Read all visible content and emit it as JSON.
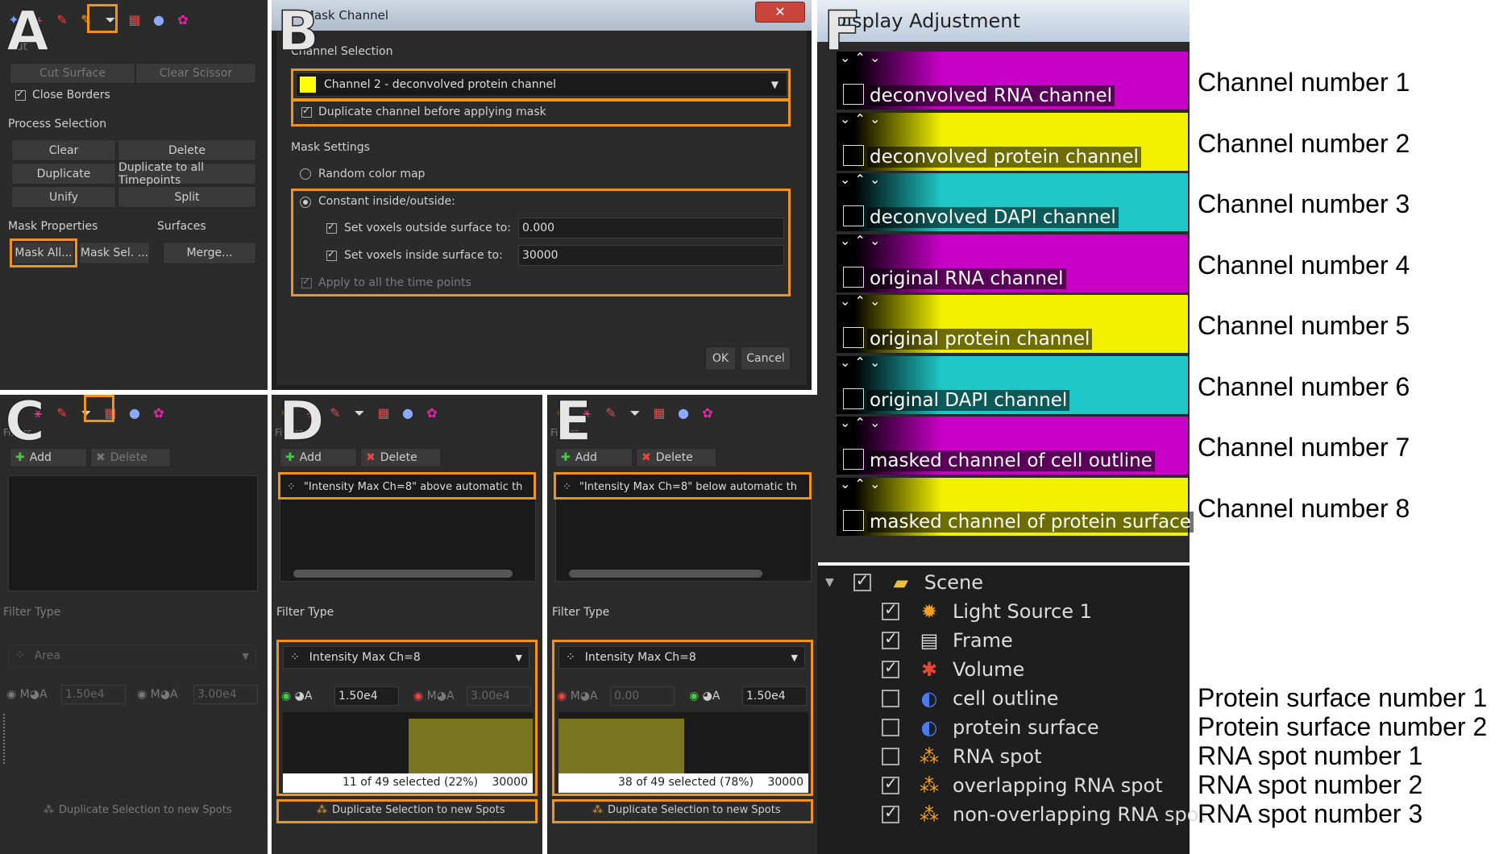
{
  "panels": {
    "a": "A",
    "b": "B",
    "c": "C",
    "d": "D",
    "e": "E",
    "f": "F"
  },
  "panelA": {
    "cut_title": "Cut",
    "cut_surface": "Cut Surface",
    "clear_scissor": "Clear Scissor",
    "close_borders": "Close Borders",
    "process_selection": "Process Selection",
    "clear": "Clear",
    "delete": "Delete",
    "duplicate": "Duplicate",
    "duplicate_all": "Duplicate to all Timepoints",
    "unify": "Unify",
    "split": "Split",
    "mask_properties": "Mask Properties",
    "surfaces": "Surfaces",
    "mask_all": "Mask All...",
    "mask_sel": "Mask Sel. ...",
    "merge": "Merge..."
  },
  "panelB": {
    "title": "Mask Channel",
    "close": "✕",
    "channel_selection": "Channel Selection",
    "channel_value": "Channel 2 - deconvolved protein channel",
    "duplicate_channel": "Duplicate channel before applying mask",
    "mask_settings": "Mask Settings",
    "random_color": "Random color map",
    "constant": "Constant inside/outside:",
    "outside_label": "Set voxels outside surface to:",
    "outside_value": "0.000",
    "inside_label": "Set voxels inside surface to:",
    "inside_value": "30000",
    "apply_all": "Apply to all the time points",
    "ok": "OK",
    "cancel": "Cancel"
  },
  "panelC": {
    "filters": "Filters",
    "add": "Add",
    "delete": "Delete",
    "filter_type": "Filter Type",
    "type_value": "Area",
    "min_value": "1.50e4",
    "max_value": "3.00e4",
    "dup": "Duplicate Selection to new Spots"
  },
  "panelD": {
    "filters": "Filters",
    "add": "Add",
    "delete": "Delete",
    "filter_item": "\"Intensity Max Ch=8\" above automatic th",
    "filter_type": "Filter Type",
    "type_value": "Intensity Max Ch=8",
    "min_value": "1.50e4",
    "max_value": "3.00e4",
    "status": "11 of 49 selected (22%)",
    "status_max": "30000",
    "dup": "Duplicate Selection to new Spots"
  },
  "panelE": {
    "filters": "Filters",
    "add": "Add",
    "delete": "Delete",
    "filter_item": "\"Intensity Max Ch=8\" below automatic th",
    "filter_type": "Filter Type",
    "type_value": "Intensity Max Ch=8",
    "min_value": "0.00",
    "max_value": "1.50e4",
    "status": "38 of 49 selected (78%)",
    "status_max": "30000",
    "dup": "Duplicate Selection to new Spots"
  },
  "panelF": {
    "title": "Display Adjustment",
    "channels": [
      {
        "name": "deconvolved RNA channel",
        "label": "Channel number 1",
        "color": "#c800c8"
      },
      {
        "name": "deconvolved protein channel",
        "label": "Channel number 2",
        "color": "#f2f200"
      },
      {
        "name": "deconvolved DAPI channel",
        "label": "Channel number 3",
        "color": "#1ec8c8"
      },
      {
        "name": "original RNA channel",
        "label": "Channel number 4",
        "color": "#c800c8"
      },
      {
        "name": "original protein channel",
        "label": "Channel number 5",
        "color": "#f2f200"
      },
      {
        "name": "original DAPI channel",
        "label": "Channel number 6",
        "color": "#1ec8c8"
      },
      {
        "name": "masked channel of cell outline",
        "label": "Channel number 7",
        "color": "#c800c8"
      },
      {
        "name": "masked channel of protein surface",
        "label": "Channel number 8",
        "color": "#f2f200"
      }
    ]
  },
  "scene": {
    "root": "Scene",
    "items": [
      {
        "name": "Light Source 1",
        "checked": true,
        "icon": "light-icon",
        "label": ""
      },
      {
        "name": "Frame",
        "checked": true,
        "icon": "frame-icon",
        "label": ""
      },
      {
        "name": "Volume",
        "checked": true,
        "icon": "volume-icon",
        "label": ""
      },
      {
        "name": "cell outline",
        "checked": false,
        "icon": "surface-icon",
        "label": "Protein surface number 1"
      },
      {
        "name": "protein surface",
        "checked": false,
        "icon": "surface-icon",
        "label": "Protein surface number 2"
      },
      {
        "name": "RNA spot",
        "checked": false,
        "icon": "spots-icon",
        "label": "RNA spot number 1"
      },
      {
        "name": "overlapping RNA spot",
        "checked": true,
        "icon": "spots-icon",
        "label": "RNA spot number 2"
      },
      {
        "name": "non-overlapping RNA spot",
        "checked": true,
        "icon": "spots-icon",
        "label": "RNA spot number 3"
      }
    ]
  }
}
